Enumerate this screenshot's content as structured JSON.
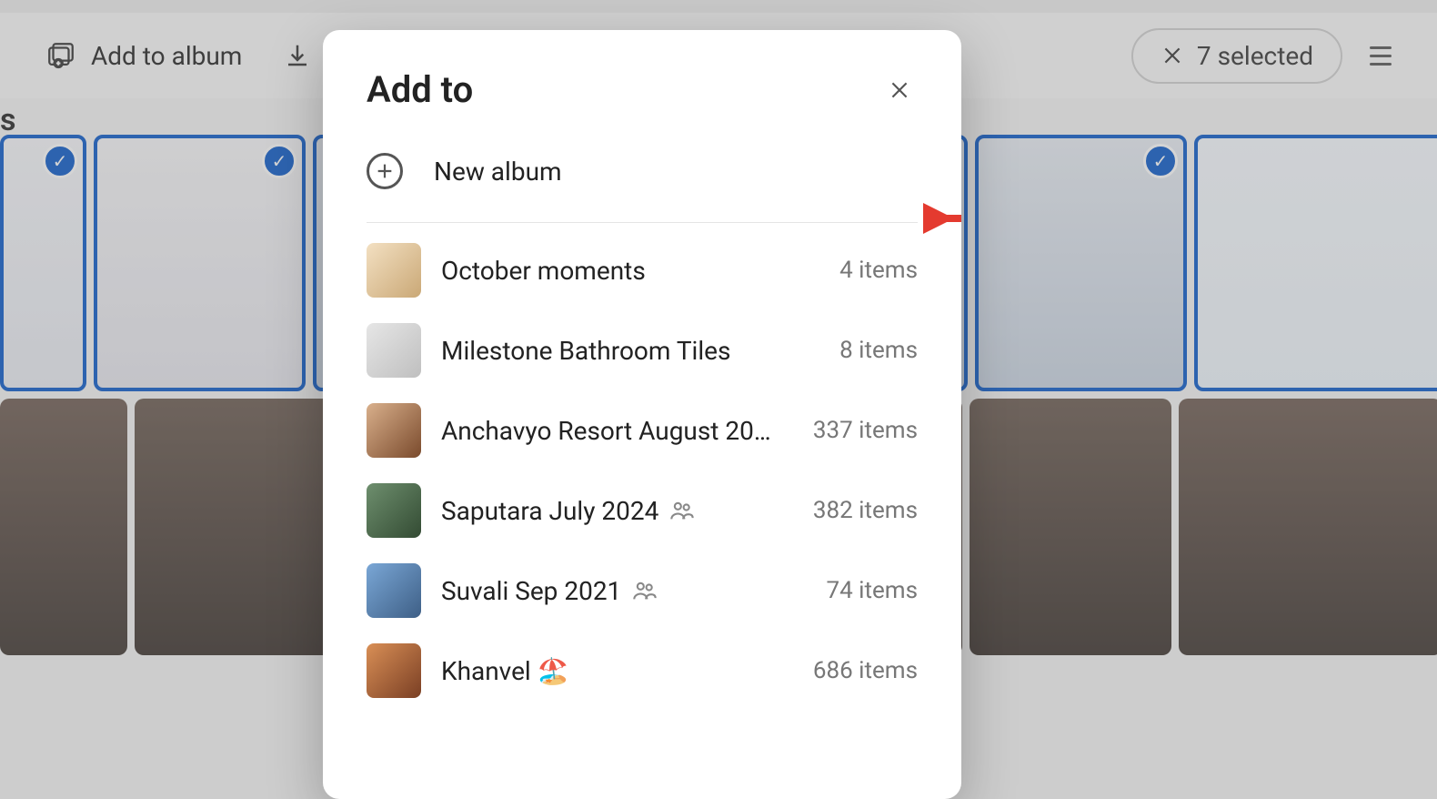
{
  "toolbar": {
    "add_to_album": "Add to album",
    "selected_label": "7 selected"
  },
  "section_title_suffix": "s",
  "modal": {
    "title": "Add to",
    "new_album_label": "New album",
    "albums": [
      {
        "name": "October moments",
        "count": "4 items",
        "shared": false
      },
      {
        "name": "Milestone Bathroom Tiles",
        "count": "8 items",
        "shared": false
      },
      {
        "name": "Anchavyo Resort August 20…",
        "count": "337 items",
        "shared": false
      },
      {
        "name": "Saputara July 2024",
        "count": "382 items",
        "shared": true
      },
      {
        "name": "Suvali Sep 2021",
        "count": "74 items",
        "shared": true
      },
      {
        "name": "Khanvel 🏖️",
        "count": "686 items",
        "shared": false
      }
    ]
  }
}
